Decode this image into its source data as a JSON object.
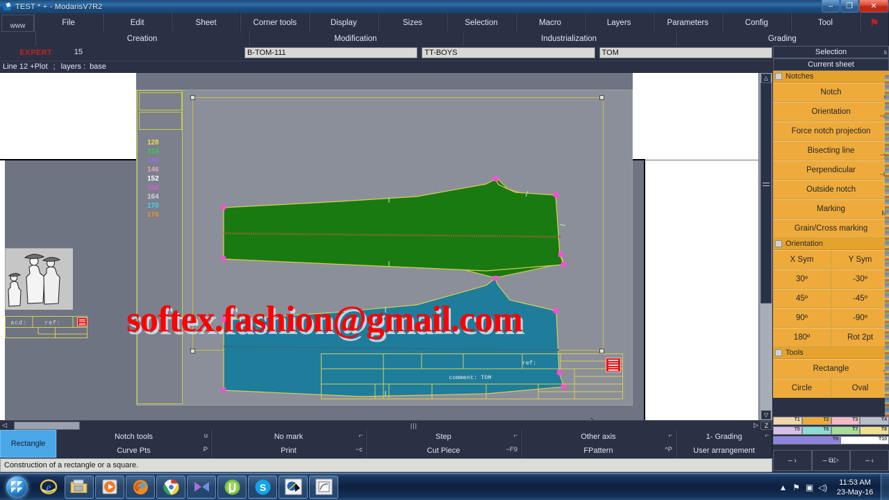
{
  "window": {
    "title": "TEST * + - ModarisV7R2",
    "minimize_label": "–",
    "restore_label": "❐",
    "close_label": "✕"
  },
  "menu": {
    "www_label": "www",
    "items": [
      {
        "label": "File"
      },
      {
        "label": "Edit"
      },
      {
        "label": "Sheet"
      },
      {
        "label": "Corner tools"
      },
      {
        "label": "Display"
      },
      {
        "label": "Sizes"
      },
      {
        "label": "Selection"
      },
      {
        "label": "Macro"
      },
      {
        "label": "Layers"
      },
      {
        "label": "Parameters"
      },
      {
        "label": "Config"
      },
      {
        "label": "Tool"
      }
    ],
    "flag_icon": "⚑"
  },
  "modes": [
    {
      "label": "Creation"
    },
    {
      "label": "Modification"
    },
    {
      "label": "Industrialization"
    },
    {
      "label": "Grading"
    }
  ],
  "fields": {
    "expert_label": "EXPERT",
    "size_value": "15",
    "model_value": "B-TOM-111",
    "collection_value": "TT-BOYS",
    "piece_value": "TOM"
  },
  "status": {
    "line_info": "Line 12 +Plot",
    "separator": ";",
    "layers_label": "layers :",
    "layers_value": "base"
  },
  "canvas": {
    "sizes": [
      {
        "label": "128",
        "color": "#e8e24a"
      },
      {
        "label": "134",
        "color": "#39c94c"
      },
      {
        "label": "140",
        "color": "#9b6fe0"
      },
      {
        "label": "146",
        "color": "#e8a8c0"
      },
      {
        "label": "152",
        "color": "#ffffff"
      },
      {
        "label": "158",
        "color": "#d25fd2"
      },
      {
        "label": "164",
        "color": "#cfd4dc"
      },
      {
        "label": "170",
        "color": "#41d6e8"
      },
      {
        "label": "176",
        "color": "#e8902e"
      }
    ],
    "titleblock": {
      "ref_label": "ref:",
      "comment_label": "comment: TOM"
    },
    "thumbtable": {
      "acd_label": "acd:",
      "ref_label": "ref:"
    },
    "watermark": "softex.fashion@gmail.com",
    "piece_green_color": "#1a7a12",
    "piece_blue_color": "#1f7d9c"
  },
  "scrollbars": {
    "h_left_arrow": "◁",
    "h_right_arrow": "▷",
    "h_grip": "|||",
    "z_label": "Z",
    "v_up_arrow": "△",
    "v_down_arrow": "▽"
  },
  "functionbar": {
    "active_tool": "Rectangle",
    "row1": [
      {
        "label": "Notch tools",
        "key": "u"
      },
      {
        "label": "No mark",
        "key": "⌐"
      },
      {
        "label": "Step",
        "key": "⌐"
      },
      {
        "label": "Other axis",
        "key": "⌐"
      },
      {
        "label": "1- Grading",
        "key": "⌐"
      }
    ],
    "row2": [
      {
        "label": "Curve Pts",
        "key": "P"
      },
      {
        "label": "Print",
        "key": "~c"
      },
      {
        "label": "Cut Piece",
        "key": "~F9"
      },
      {
        "label": "FPattern",
        "key": "^P"
      },
      {
        "label": "User arrangement",
        "key": ""
      }
    ]
  },
  "bottom_status": "Construction of a rectangle or a square.",
  "rightpanel": {
    "header": [
      {
        "label": "Selection",
        "shortcut": "s"
      },
      {
        "label": "Current sheet",
        "shortcut": ""
      }
    ],
    "groups": [
      {
        "title": "Notches",
        "rows": [
          [
            {
              "label": "Notch",
              "key": "c"
            }
          ],
          [
            {
              "label": "Orientation",
              "key": "~u"
            }
          ],
          [
            {
              "label": "Force notch projection",
              "key": ""
            }
          ],
          [
            {
              "label": "Bisecting line",
              "key": "~y"
            }
          ],
          [
            {
              "label": "Perpendicular",
              "key": "~h"
            }
          ],
          [
            {
              "label": "Outside notch",
              "key": ""
            }
          ],
          [
            {
              "label": "Marking",
              "key": "M"
            }
          ],
          [
            {
              "label": "Grain/Cross marking",
              "key": ""
            }
          ]
        ]
      },
      {
        "title": "Orientation",
        "rows": [
          [
            {
              "label": "X Sym",
              "key": ""
            },
            {
              "label": "Y Sym",
              "key": ""
            }
          ],
          [
            {
              "label": "30º",
              "key": ""
            },
            {
              "label": "-30º",
              "key": ""
            }
          ],
          [
            {
              "label": "45º",
              "key": ""
            },
            {
              "label": "-45º",
              "key": ""
            }
          ],
          [
            {
              "label": "90º",
              "key": ""
            },
            {
              "label": "-90º",
              "key": ""
            }
          ],
          [
            {
              "label": "180º",
              "key": ""
            },
            {
              "label": "Rot 2pt",
              "key": ""
            }
          ]
        ]
      },
      {
        "title": "Tools",
        "rows": [
          [
            {
              "label": "Rectangle",
              "key": "T"
            }
          ],
          [
            {
              "label": "Circle",
              "key": ""
            },
            {
              "label": "Oval",
              "key": ""
            }
          ]
        ]
      }
    ],
    "swatch_rows": [
      [
        {
          "label": "T1",
          "color": "#f2d5a8"
        },
        {
          "label": "T2",
          "color": "#eeab3c"
        },
        {
          "label": "T3",
          "color": "#f3b9c6"
        },
        {
          "label": "T4",
          "color": "#b9bec8"
        }
      ],
      [
        {
          "label": "T5",
          "color": "#d8bfe8"
        },
        {
          "label": "T6",
          "color": "#8ddcd3"
        },
        {
          "label": "T7",
          "color": "#a9de96"
        },
        {
          "label": "T8",
          "color": "#f0e08a"
        }
      ],
      [
        {
          "label": "T9",
          "color": "#8e84e0"
        },
        {
          "label": "T10",
          "color": "#ffffff"
        }
      ]
    ],
    "nav": [
      {
        "label": "–  ›"
      },
      {
        "label": "– ⧉▷"
      },
      {
        "label": "–  ‹"
      }
    ]
  },
  "taskbar": {
    "start_label": "Start",
    "items": [
      {
        "name": "internet-explorer",
        "pinned": false
      },
      {
        "name": "windows-explorer",
        "pinned": true
      },
      {
        "name": "media-player",
        "pinned": true
      },
      {
        "name": "firefox",
        "pinned": true
      },
      {
        "name": "chrome",
        "pinned": true
      },
      {
        "name": "movie-maker",
        "pinned": true
      },
      {
        "name": "utorrent",
        "pinned": true
      },
      {
        "name": "skype",
        "pinned": true
      },
      {
        "name": "modaris",
        "pinned": true
      },
      {
        "name": "diamino",
        "pinned": true
      }
    ],
    "tray": {
      "show_hidden": "▲",
      "network": "⚑",
      "display": "▣",
      "volume": "◁)",
      "time": "11:53 AM",
      "date": "23-May-16"
    }
  }
}
